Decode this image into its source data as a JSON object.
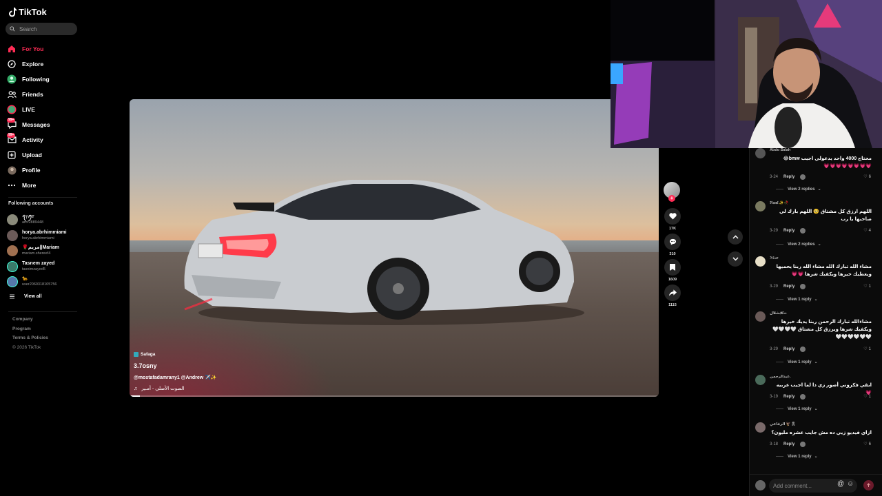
{
  "app": {
    "name": "TikTok"
  },
  "search": {
    "placeholder": "Search"
  },
  "nav": [
    {
      "label": "For You",
      "icon": "home-icon",
      "active": true
    },
    {
      "label": "Explore",
      "icon": "compass-icon"
    },
    {
      "label": "Following",
      "icon": "following-icon"
    },
    {
      "label": "Friends",
      "icon": "friends-icon"
    },
    {
      "label": "LIVE",
      "icon": "live-icon"
    },
    {
      "label": "Messages",
      "icon": "messages-icon",
      "badge": "99+"
    },
    {
      "label": "Activity",
      "icon": "activity-icon",
      "badge": "99+"
    },
    {
      "label": "Upload",
      "icon": "upload-icon"
    },
    {
      "label": "Profile",
      "icon": "profile-icon"
    },
    {
      "label": "More",
      "icon": "more-icon"
    }
  ],
  "following_accounts": {
    "title": "Following accounts",
    "items": [
      {
        "name": "ꪖ᥅ꪑ𝕣",
        "handle": "amr2889448"
      },
      {
        "name": "horya.abrhimmiami",
        "handle": "horya.abrhimmiami"
      },
      {
        "name": "🌹مريم||Mariam",
        "handle": "mariam.shereef4"
      },
      {
        "name": "Tasnem zayed",
        "handle": "tasnimzayed5"
      },
      {
        "name": "🐆",
        "handle": "user2060318105756"
      }
    ],
    "view_all": "View all"
  },
  "footer": {
    "links": [
      "Company",
      "Program",
      "Terms & Policies"
    ],
    "copyright": "© 2026 TikTok"
  },
  "video": {
    "location": "Safaga",
    "author": "3.7osny",
    "caption": "@mostafadamrany1 @Andrew ✈️✨",
    "music": "الصوت الأصلي - أمـير",
    "progress": 0.02
  },
  "actions": {
    "likes": "17K",
    "comments": "310",
    "saves": "1609",
    "shares": "1115"
  },
  "comments": [
    {
      "user": "Abdo Salah",
      "text": "محتاج 4000 واحد يدعولي اجيب bmw😂\n💗💗💗💗💗💗💗💗",
      "date": "3-24",
      "reply": "Reply",
      "likes": "6",
      "view_replies": "View 2 replies"
    },
    {
      "user": "ℜ𝔢𝔰𝔞𝔩 ✨🥀",
      "text": "اللهم ارزق كل مشتاق 🥺 اللهم بارك لي صاحبها يا رب",
      "date": "3-29",
      "reply": "Reply",
      "likes": "4",
      "view_replies": "View 2 replies"
    },
    {
      "user": "ℳℴℯ",
      "text": "مشاء الله تبارك الله مشاء الله ربنا يحميها ويعطيك خيرها ويكفيك شرها 💗💗",
      "date": "3-29",
      "reply": "Reply",
      "likes": "1",
      "view_replies": "View 1 reply"
    },
    {
      "user": "شلال𝓚ℴℴ",
      "text": "مشاءالله تبارك الرحمن ربنا يديك خيرها ويكفيك شرها ويرزق كل مشتاق 🤍🤍🤍🤍🤍🤍🤍🤍🤍🤍",
      "date": "3-29",
      "reply": "Reply",
      "likes": "1",
      "view_replies": "View 1 reply"
    },
    {
      "user": "عبدالرحمن.",
      "text": "ابقي فكروني أصور زي دا لما اجيب عربيه 💗",
      "date": "3-19",
      "reply": "Reply",
      "likes": "1",
      "view_replies": "View 1 reply"
    },
    {
      "user": "الرفاعي 🦅🎗",
      "text": "ازاي فيديو زيي ده مش جايب عشره مليون؟",
      "date": "3-18",
      "reply": "Reply",
      "likes": "6",
      "view_replies": "View 1 reply"
    }
  ],
  "add_comment": {
    "placeholder": "Add comment..."
  },
  "colors": {
    "accent": "#fe2c55",
    "background": "#000000",
    "panel": "#0b0b0b"
  }
}
